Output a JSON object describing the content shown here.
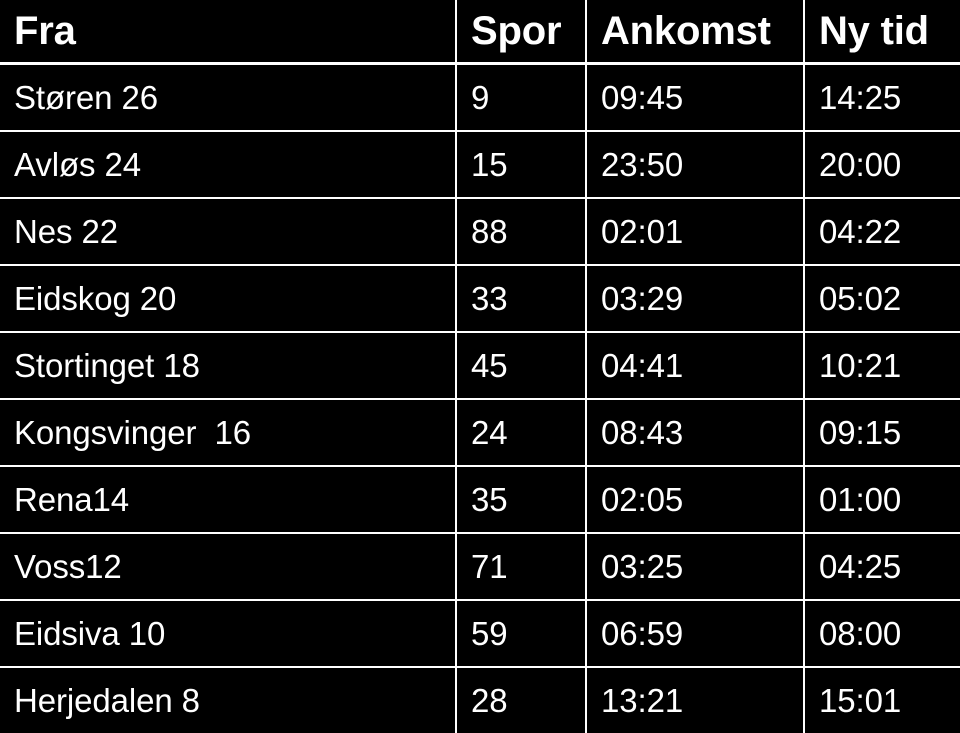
{
  "board": {
    "title": "Fra",
    "background_color": "#000000",
    "text_color": "#ffffff",
    "line_color": "#ffffff"
  },
  "table": {
    "columns": [
      {
        "key": "fra",
        "label": "Fra"
      },
      {
        "key": "spor",
        "label": "Spor"
      },
      {
        "key": "ankomst",
        "label": "Ankomst"
      },
      {
        "key": "nytid",
        "label": "Ny tid"
      }
    ],
    "rows": [
      {
        "fra": "Støren 26",
        "spor": "9",
        "ankomst": "09:45",
        "nytid": "14:25"
      },
      {
        "fra": "Avløs 24",
        "spor": "15",
        "ankomst": "23:50",
        "nytid": "20:00"
      },
      {
        "fra": "Nes 22",
        "spor": "88",
        "ankomst": "02:01",
        "nytid": "04:22"
      },
      {
        "fra": "Eidskog 20",
        "spor": "33",
        "ankomst": "03:29",
        "nytid": "05:02"
      },
      {
        "fra": "Stortinget 18",
        "spor": "45",
        "ankomst": "04:41",
        "nytid": "10:21"
      },
      {
        "fra": "Kongsvinger  16",
        "spor": "24",
        "ankomst": "08:43",
        "nytid": "09:15"
      },
      {
        "fra": "Rena14",
        "spor": "35",
        "ankomst": "02:05",
        "nytid": "01:00"
      },
      {
        "fra": "Voss12",
        "spor": "71",
        "ankomst": "03:25",
        "nytid": "04:25"
      },
      {
        "fra": "Eidsiva 10",
        "spor": "59",
        "ankomst": "06:59",
        "nytid": "08:00"
      },
      {
        "fra": "Herjedalen 8",
        "spor": "28",
        "ankomst": "13:21",
        "nytid": "15:01"
      }
    ]
  }
}
